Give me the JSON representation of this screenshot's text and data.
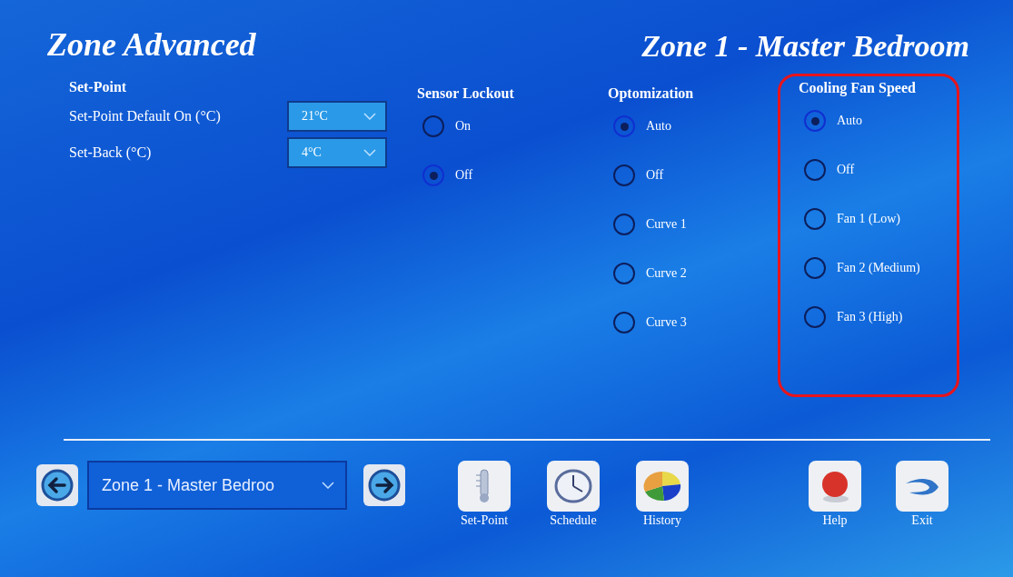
{
  "title": "Zone Advanced",
  "zone_title": "Zone 1 - Master Bedroom",
  "set_point": {
    "heading": "Set-Point",
    "fields": [
      {
        "label": "Set-Point Default On (°C)",
        "value": "21°C"
      },
      {
        "label": "Set-Back (°C)",
        "value": "4°C"
      }
    ]
  },
  "radio_groups": [
    {
      "heading": "Sensor Lockout",
      "highlighted": false,
      "options": [
        {
          "label": "On",
          "selected": false
        },
        {
          "label": "Off",
          "selected": true
        }
      ]
    },
    {
      "heading": "Optomization",
      "highlighted": false,
      "options": [
        {
          "label": "Auto",
          "selected": true
        },
        {
          "label": "Off",
          "selected": false
        },
        {
          "label": "Curve 1",
          "selected": false
        },
        {
          "label": "Curve 2",
          "selected": false
        },
        {
          "label": "Curve 3",
          "selected": false
        }
      ]
    },
    {
      "heading": "Cooling Fan Speed",
      "highlighted": true,
      "options": [
        {
          "label": "Auto",
          "selected": true
        },
        {
          "label": "Off",
          "selected": false
        },
        {
          "label": "Fan 1 (Low)",
          "selected": false
        },
        {
          "label": "Fan 2 (Medium)",
          "selected": false
        },
        {
          "label": "Fan 3 (High)",
          "selected": false
        }
      ]
    }
  ],
  "zone_select": "Zone 1 - Master Bedroo",
  "buttons": [
    {
      "label": "Set-Point",
      "kind": "setpoint"
    },
    {
      "label": "Schedule",
      "kind": "schedule"
    },
    {
      "label": "History",
      "kind": "history"
    },
    {
      "label": "Help",
      "kind": "help"
    },
    {
      "label": "Exit",
      "kind": "exit"
    }
  ]
}
